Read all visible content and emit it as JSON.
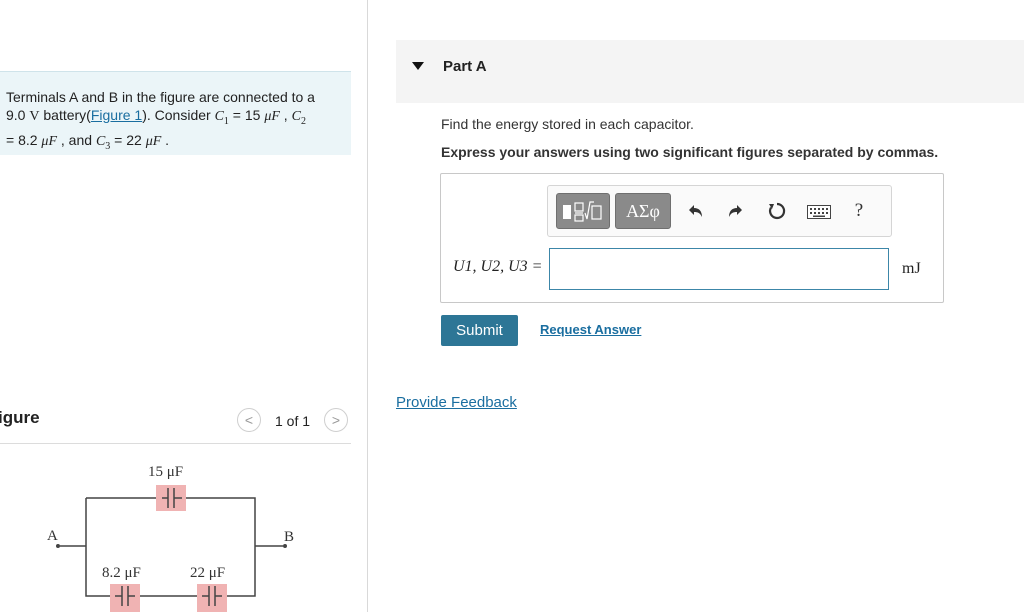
{
  "problem": {
    "text_1": "Terminals A and B in the figure are connected to a",
    "voltage": "9.0",
    "unit_V": "V",
    "text_2": " battery(",
    "figure_link": "Figure 1",
    "text_3": "). Consider ",
    "c1_sym": "C",
    "c1_sub": "1",
    "c1_val": " = 15 ",
    "unit_uF": "μF",
    "text_4": " , ",
    "c2_sym": "C",
    "c2_sub": "2",
    "c2_val": "= 8.2 ",
    "text_5": " , and ",
    "c3_sym": "C",
    "c3_sub": "3",
    "c3_val": " = 22 ",
    "text_6": " ."
  },
  "figure": {
    "title": "igure",
    "pager_text": "1 of 1",
    "prev_icon": "chevron-left-icon",
    "next_icon": "chevron-right-icon",
    "circuit": {
      "terminal_a": "A",
      "terminal_b": "B",
      "c1_label": "15 μF",
      "c2_label": "8.2 μF",
      "c3_label": "22 μF",
      "highlight_color": "#f0b3b3",
      "wire_color": "#444444"
    }
  },
  "part": {
    "title": "Part A",
    "instruction": "Find the energy stored in each capacitor.",
    "express": "Express your answers using two significant figures separated by commas."
  },
  "toolbar": {
    "templates_icon": "templates-icon",
    "greek_label": "ΑΣφ",
    "undo_icon": "undo-icon",
    "redo_icon": "redo-icon",
    "reset_icon": "reset-icon",
    "keyboard_icon": "keyboard-icon",
    "help_label": "?"
  },
  "answer": {
    "label": "U1, U2, U3 =",
    "value": "",
    "unit": "mJ"
  },
  "actions": {
    "submit": "Submit",
    "request_answer": "Request Answer",
    "feedback": "Provide Feedback"
  },
  "colors": {
    "accent": "#2d7696",
    "link": "#1a6ea0",
    "problem_bg": "#ebf5f8"
  }
}
